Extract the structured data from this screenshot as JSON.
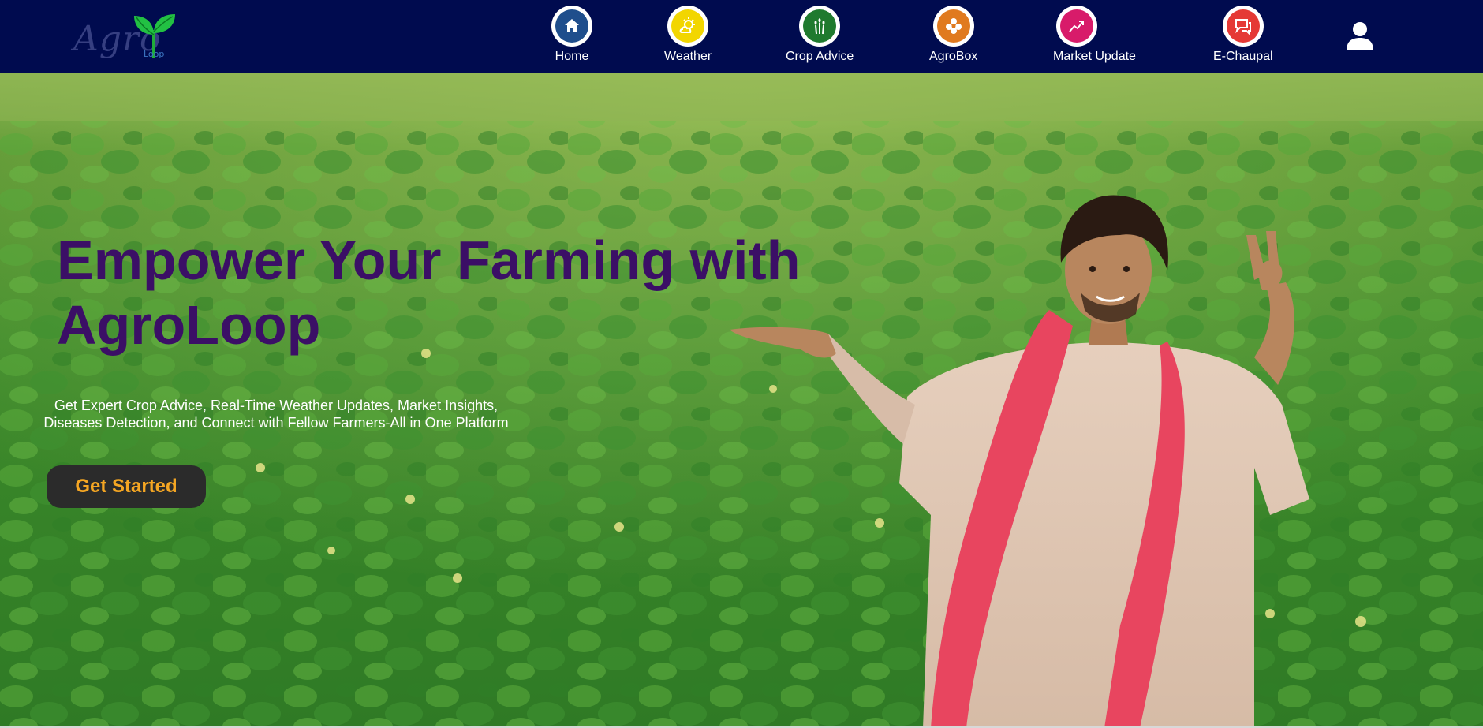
{
  "brand": {
    "logo_text": "Agro",
    "logo_sub": "Loop"
  },
  "nav": {
    "items": [
      {
        "label": "Home",
        "icon": "home-icon",
        "color": "#1f4e8c"
      },
      {
        "label": "Weather",
        "icon": "weather-icon",
        "color": "#f2d600"
      },
      {
        "label": "Crop Advice",
        "icon": "crop-icon",
        "color": "#1f7a2e"
      },
      {
        "label": "AgroBox",
        "icon": "agrobox-icon",
        "color": "#e07a1f"
      },
      {
        "label": "Market Update",
        "icon": "market-chart-icon",
        "color": "#d81b6a"
      },
      {
        "label": "E-Chaupal",
        "icon": "chat-icon",
        "color": "#e53935"
      }
    ],
    "profile_icon": "user-profile-icon"
  },
  "hero": {
    "title_line1": "Empower Your Farming with",
    "title_line2": "AgroLoop",
    "subtitle": "Get Expert Crop Advice, Real-Time Weather Updates, Market Insights, Diseases Detection, and Connect with Fellow Farmers-All in One Platform",
    "cta_label": "Get Started"
  },
  "colors": {
    "navbar_bg": "#000b4f",
    "title": "#3b0f66",
    "cta_bg": "#2b2b2b",
    "cta_text": "#f5a623"
  }
}
